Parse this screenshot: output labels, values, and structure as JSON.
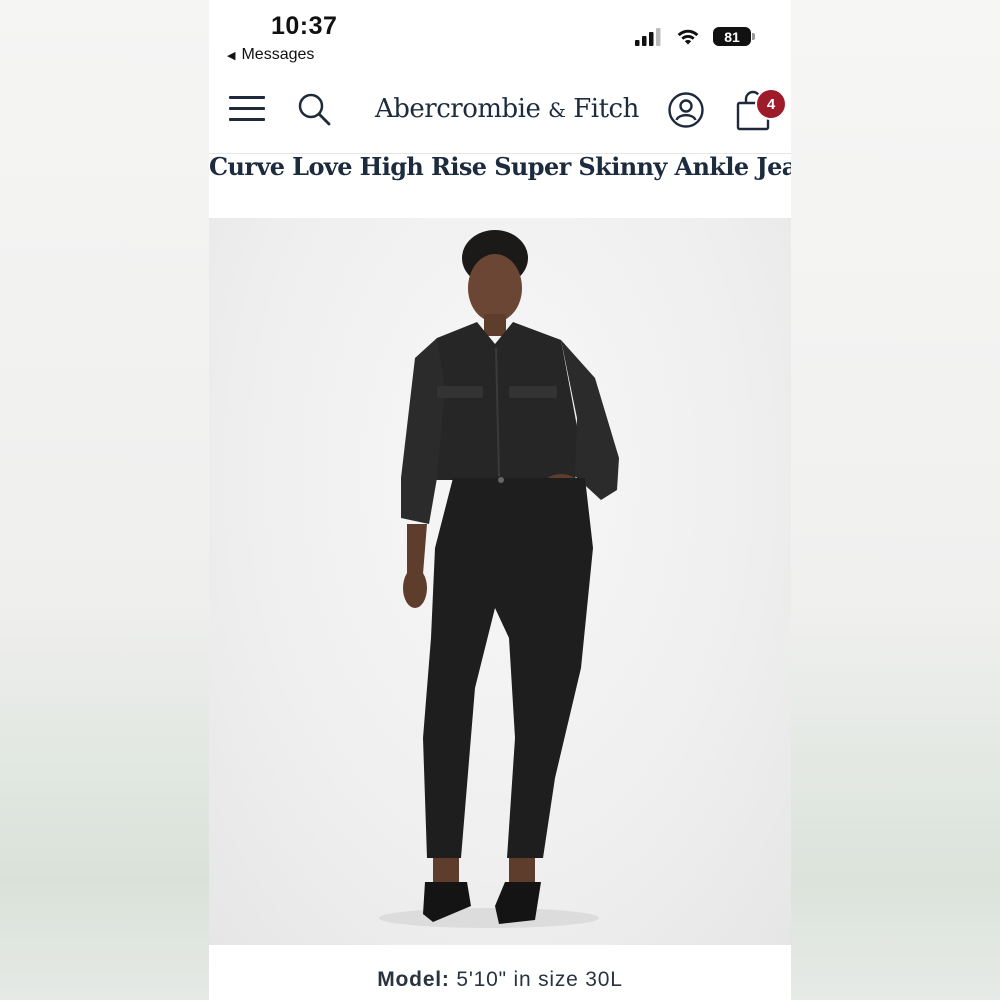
{
  "status_bar": {
    "time": "10:37",
    "back_app": "Messages",
    "battery": "81"
  },
  "header": {
    "brand": "Abercrombie",
    "brand_amp": "&",
    "brand_tail": "Fitch",
    "cart_count": "4",
    "icons": [
      "menu-icon",
      "search-icon",
      "account-icon",
      "shopping-bag-icon"
    ],
    "accent_color": "#9e1b2a",
    "text_color": "#1d2b3e"
  },
  "product": {
    "title": "Curve Love High Rise Super Skinny Ankle Jean",
    "model_label": "Model:",
    "model_value": "5'10\" in size 30L"
  }
}
